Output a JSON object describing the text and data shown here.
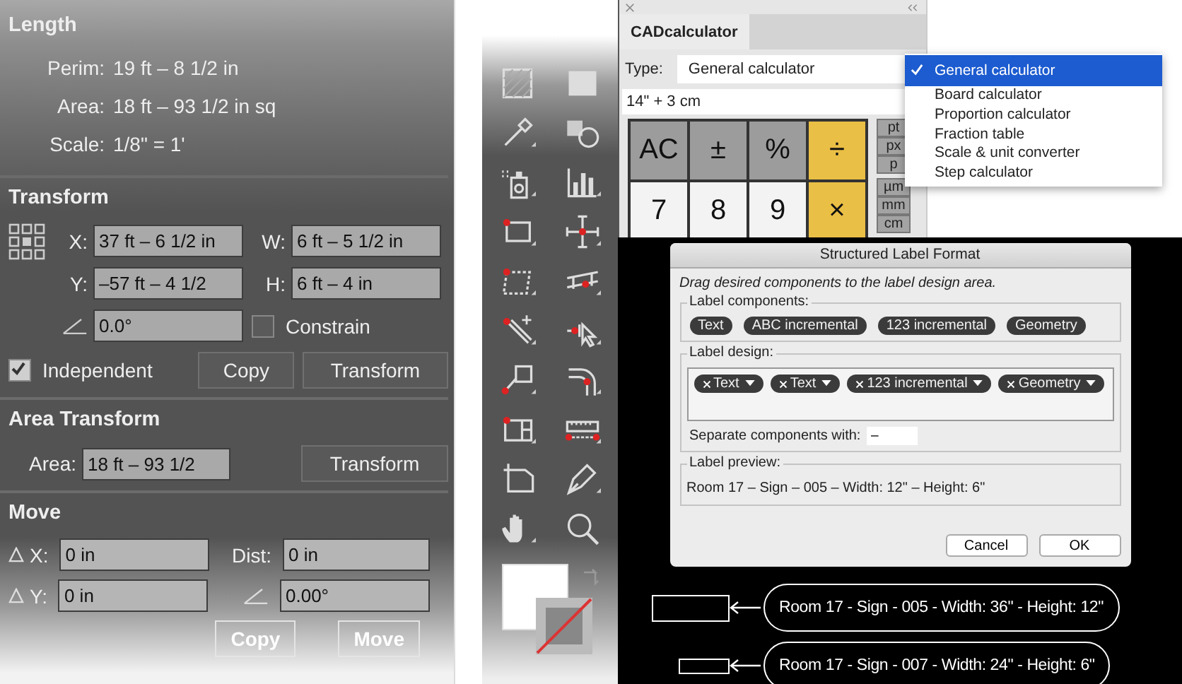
{
  "measure": {
    "title": "Length",
    "readouts": [
      {
        "label": "Perim:",
        "value": "19 ft – 8 1/2 in"
      },
      {
        "label": "Area:",
        "value": "18 ft – 93 1/2 in sq"
      },
      {
        "label": "Scale:",
        "value": "1/8\" = 1'"
      }
    ]
  },
  "transform": {
    "title": "Transform",
    "fields": [
      {
        "label": "X:",
        "value": "37 ft – 6 1/2 in"
      },
      {
        "label": "W:",
        "value": "6 ft – 5 1/2 in"
      },
      {
        "label": "Y:",
        "value": "–57 ft – 4 1/2"
      },
      {
        "label": "H:",
        "value": "6 ft – 4 in"
      }
    ],
    "angle": "0.0°",
    "constrain": {
      "label": "Constrain",
      "checked": false
    },
    "independent": {
      "label": "Independent",
      "checked": true
    },
    "buttons": [
      "Copy",
      "Transform"
    ]
  },
  "area_transform": {
    "title": "Area Transform",
    "label": "Area:",
    "value": "18 ft – 93 1/2",
    "button": "Transform"
  },
  "move": {
    "title": "Move",
    "fields": [
      {
        "kind": "delta",
        "label": "X:",
        "value": "0 in"
      },
      {
        "kind": "plain",
        "label": "Dist:",
        "value": "0 in"
      },
      {
        "kind": "delta",
        "label": "Y:",
        "value": "0 in"
      },
      {
        "kind": "angle",
        "value": "0.00°"
      }
    ],
    "buttons": [
      "Copy",
      "Move"
    ]
  },
  "calculator": {
    "tab": "CADcalculator",
    "type_label": "Type:",
    "type_value": "General calculator",
    "expression": "14\" + 3 cm",
    "keys": [
      {
        "label": "AC",
        "kind": "function"
      },
      {
        "label": "±",
        "kind": "function"
      },
      {
        "label": "%",
        "kind": "function"
      },
      {
        "label": "÷",
        "kind": "operator"
      },
      {
        "label": "7",
        "kind": "digit"
      },
      {
        "label": "8",
        "kind": "digit"
      },
      {
        "label": "9",
        "kind": "digit"
      },
      {
        "label": "×",
        "kind": "operator"
      }
    ],
    "units": [
      [
        "pt",
        "px",
        "p"
      ],
      [
        "µm",
        "mm",
        "cm"
      ]
    ],
    "menu": [
      {
        "label": "General calculator",
        "selected": true
      },
      {
        "label": "Board calculator",
        "selected": false
      },
      {
        "label": "Proportion calculator",
        "selected": false
      },
      {
        "label": "Fraction table",
        "selected": false
      },
      {
        "label": "Scale & unit converter",
        "selected": false
      },
      {
        "label": "Step calculator",
        "selected": false
      }
    ]
  },
  "dialog": {
    "title": "Structured Label Format",
    "instruction": "Drag desired components to the label design area.",
    "components_legend": "Label components:",
    "components": [
      "Text",
      "ABC incremental",
      "123 incremental",
      "Geometry"
    ],
    "design_legend": "Label design:",
    "design": [
      "Text",
      "Text",
      "123 incremental",
      "Geometry"
    ],
    "separator_label": "Separate components with:",
    "separator_value": "–",
    "preview_legend": "Label preview:",
    "preview": "Room 17 – Sign – 005 – Width: 12\" – Height: 6\"",
    "buttons": [
      "Cancel",
      "OK"
    ]
  },
  "callouts": [
    {
      "kind": "large",
      "text": "Room 17 - Sign - 005 - Width: 36\" - Height: 12\""
    },
    {
      "kind": "small",
      "text": "Room 17 - Sign - 007 - Width: 24\" - Height: 6\""
    }
  ]
}
